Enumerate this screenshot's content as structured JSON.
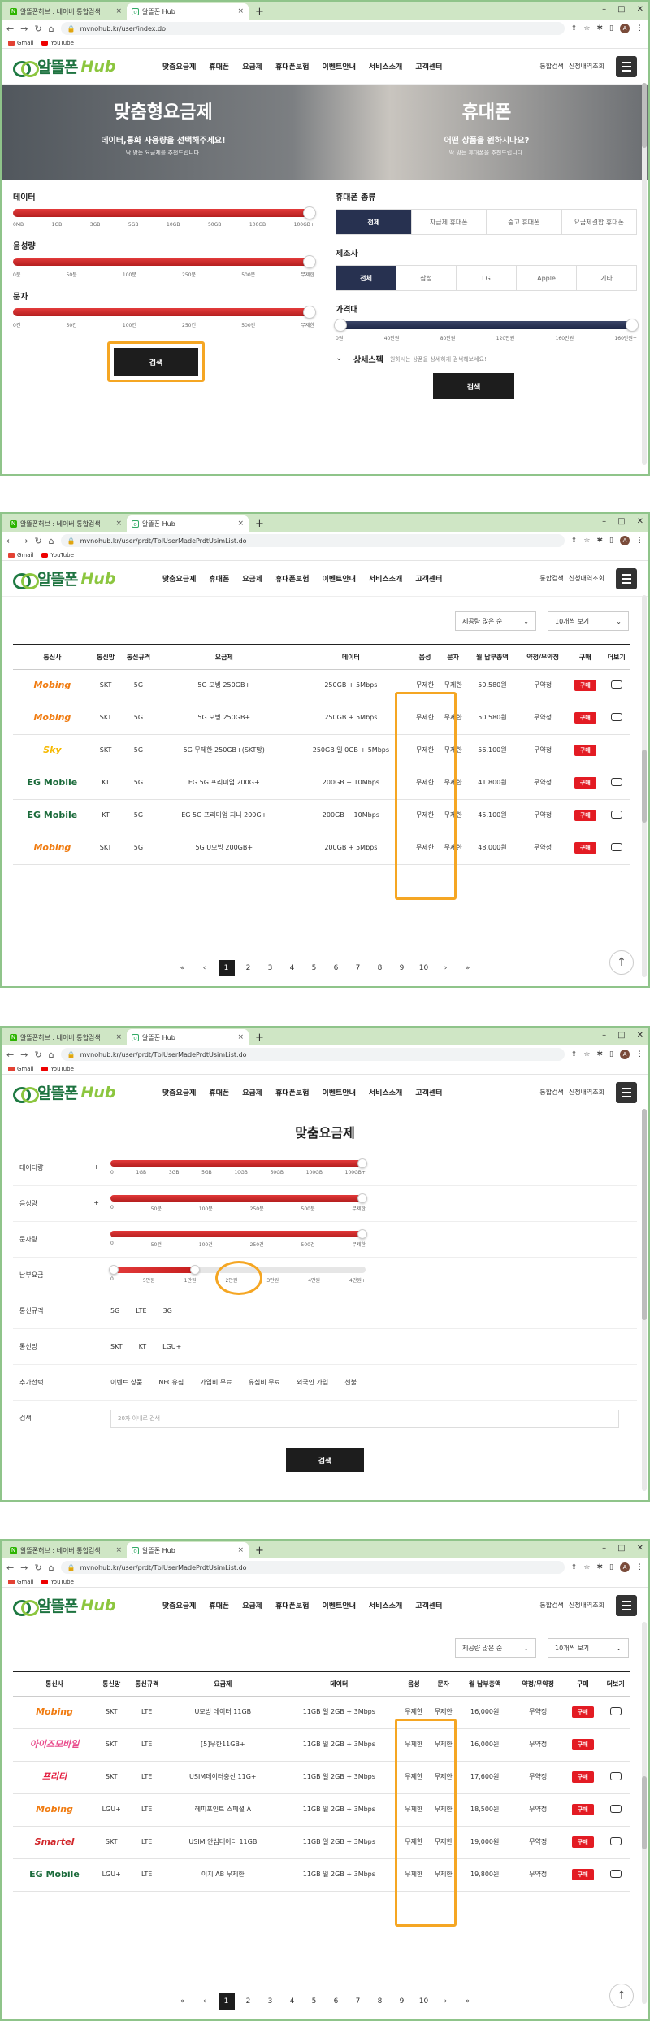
{
  "browser": {
    "tab1": "알뜰폰허브 : 네이버 통합검색",
    "tab2": "알뜰폰 Hub",
    "new_tab": "+",
    "url1": "mvnohub.kr/user/index.do",
    "url2": "mvnohub.kr/user/prdt/TblUserMadePrdtUsimList.do",
    "bookmarks": [
      "Gmail",
      "YouTube"
    ],
    "avatar": "A"
  },
  "site": {
    "logo": "알뜰폰",
    "logo_hub": "Hub",
    "nav": [
      "맞춤요금제",
      "휴대폰",
      "요금제",
      "휴대폰보험",
      "이벤트안내",
      "서비스소개",
      "고객센터"
    ],
    "util": [
      "통합검색",
      "신청내역조회"
    ]
  },
  "frame1": {
    "hero_left_title": "맞춤형요금제",
    "hero_left_sub": "데이터,통화 사용량을 선택해주세요!",
    "hero_left_small": "딱 맞는 요금제를 추천드립니다.",
    "hero_right_title": "휴대폰",
    "hero_right_sub": "어떤 상품을 원하시나요?",
    "hero_right_small": "딱 맞는 휴대폰을 추천드립니다.",
    "data_label": "데이터",
    "data_ticks": [
      "0MB",
      "1GB",
      "3GB",
      "5GB",
      "10GB",
      "50GB",
      "100GB",
      "100GB+"
    ],
    "voice_label": "음성량",
    "voice_ticks": [
      "0분",
      "50분",
      "100분",
      "250분",
      "500분",
      "무제한"
    ],
    "sms_label": "문자",
    "sms_ticks": [
      "0건",
      "50건",
      "100건",
      "250건",
      "500건",
      "무제한"
    ],
    "search": "검색",
    "phone_type_label": "휴대폰 종류",
    "phone_types": [
      "전체",
      "자급제 휴대폰",
      "중고 휴대폰",
      "요금제결합 휴대폰"
    ],
    "maker_label": "제조사",
    "makers": [
      "전체",
      "삼성",
      "LG",
      "Apple",
      "기타"
    ],
    "price_label": "가격대",
    "price_ticks": [
      "0원",
      "40만원",
      "80만원",
      "120만원",
      "160만원",
      "160만원+"
    ],
    "detail_title": "상세스펙",
    "detail_hint": "원하시는 상품을 상세하게 검색해보세요!"
  },
  "table_common": {
    "sort": "제공량 많은 순",
    "per_page": "10개씩 보기",
    "headers": [
      "통신사",
      "통신망",
      "통신규격",
      "요금제",
      "데이터",
      "음성",
      "문자",
      "월 납부총액",
      "약정/무약정",
      "구매",
      "더보기"
    ],
    "buy": "구매",
    "pages": [
      "1",
      "2",
      "3",
      "4",
      "5",
      "6",
      "7",
      "8",
      "9",
      "10"
    ],
    "prev2": "«",
    "prev": "‹",
    "next": "›",
    "next2": "»"
  },
  "frame2_rows": [
    {
      "carrier": "Mobing",
      "net": "SKT",
      "std": "5G",
      "plan": "5G 모빙 250GB+",
      "data": "250GB + 5Mbps",
      "voice": "무제한",
      "sms": "무제한",
      "price": "50,580원",
      "contract": "무약정",
      "more": true
    },
    {
      "carrier": "Mobing",
      "net": "SKT",
      "std": "5G",
      "plan": "5G 모빙 250GB+",
      "data": "250GB + 5Mbps",
      "voice": "무제한",
      "sms": "무제한",
      "price": "50,580원",
      "contract": "무약정",
      "more": true
    },
    {
      "carrier": "Sky",
      "net": "SKT",
      "std": "5G",
      "plan": "5G 무제한 250GB+(SKT망)",
      "data": "250GB 일 0GB + 5Mbps",
      "voice": "무제한",
      "sms": "무제한",
      "price": "56,100원",
      "contract": "무약정",
      "more": false
    },
    {
      "carrier": "EG Mobile",
      "net": "KT",
      "std": "5G",
      "plan": "EG 5G 프리미엄 200G+",
      "data": "200GB + 10Mbps",
      "voice": "무제한",
      "sms": "무제한",
      "price": "41,800원",
      "contract": "무약정",
      "more": true
    },
    {
      "carrier": "EG Mobile",
      "net": "KT",
      "std": "5G",
      "plan": "EG 5G 프리미엄 지니 200G+",
      "data": "200GB + 10Mbps",
      "voice": "무제한",
      "sms": "무제한",
      "price": "45,100원",
      "contract": "무약정",
      "more": true
    },
    {
      "carrier": "Mobing",
      "net": "SKT",
      "std": "5G",
      "plan": "5G U모빙 200GB+",
      "data": "200GB + 5Mbps",
      "voice": "무제한",
      "sms": "무제한",
      "price": "48,000원",
      "contract": "무약정",
      "more": true
    }
  ],
  "frame3": {
    "title": "맞춤요금제",
    "data_label": "데이터량",
    "data_ticks": [
      "0",
      "1GB",
      "3GB",
      "5GB",
      "10GB",
      "50GB",
      "100GB",
      "100GB+"
    ],
    "voice_label": "음성량",
    "voice_ticks": [
      "0",
      "50분",
      "100분",
      "250분",
      "500분",
      "무제한"
    ],
    "sms_label": "문자량",
    "sms_ticks": [
      "0",
      "50건",
      "100건",
      "250건",
      "500건",
      "무제한"
    ],
    "fee_label": "납부요금",
    "fee_ticks": [
      "0",
      "5만원",
      "1만원",
      "2만원",
      "3만원",
      "4만원",
      "4만원+"
    ],
    "std_label": "통신규격",
    "std_chips": [
      "5G",
      "LTE",
      "3G"
    ],
    "net_label": "통신망",
    "net_chips": [
      "SKT",
      "KT",
      "LGU+"
    ],
    "extra_label": "추가선택",
    "extra_chips": [
      "이벤트 상품",
      "NFC유심",
      "가입비 무료",
      "유심비 무료",
      "외국인 가입",
      "선불"
    ],
    "search_label": "검색",
    "search_placeholder": "20자 이내로 검색",
    "search": "검색",
    "plus": "+"
  },
  "frame4_rows": [
    {
      "carrier": "Mobing",
      "net": "SKT",
      "std": "LTE",
      "plan": "U모빙 데이터 11GB",
      "data": "11GB 일 2GB + 3Mbps",
      "voice": "무제한",
      "sms": "무제한",
      "price": "16,000원",
      "contract": "무약정",
      "more": true
    },
    {
      "carrier": "아이즈모바일",
      "net": "SKT",
      "std": "LTE",
      "plan": "[5]무한11GB+",
      "data": "11GB 일 2GB + 3Mbps",
      "voice": "무제한",
      "sms": "무제한",
      "price": "16,000원",
      "contract": "무약정",
      "more": false
    },
    {
      "carrier": "프리티",
      "net": "SKT",
      "std": "LTE",
      "plan": "USIM데이터충신 11G+",
      "data": "11GB 일 2GB + 3Mbps",
      "voice": "무제한",
      "sms": "무제한",
      "price": "17,600원",
      "contract": "무약정",
      "more": true
    },
    {
      "carrier": "Mobing",
      "net": "LGU+",
      "std": "LTE",
      "plan": "헤피포인트 스페셜 A",
      "data": "11GB 일 2GB + 3Mbps",
      "voice": "무제한",
      "sms": "무제한",
      "price": "18,500원",
      "contract": "무약정",
      "more": true
    },
    {
      "carrier": "Smartel",
      "net": "SKT",
      "std": "LTE",
      "plan": "USIM 안심데이터 11GB",
      "data": "11GB 일 2GB + 3Mbps",
      "voice": "무제한",
      "sms": "무제한",
      "price": "19,000원",
      "contract": "무약정",
      "more": true
    },
    {
      "carrier": "EG Mobile",
      "net": "LGU+",
      "std": "LTE",
      "plan": "이지 AB 무제한",
      "data": "11GB 일 2GB + 3Mbps",
      "voice": "무제한",
      "sms": "무제한",
      "price": "19,800원",
      "contract": "무약정",
      "more": true
    }
  ]
}
